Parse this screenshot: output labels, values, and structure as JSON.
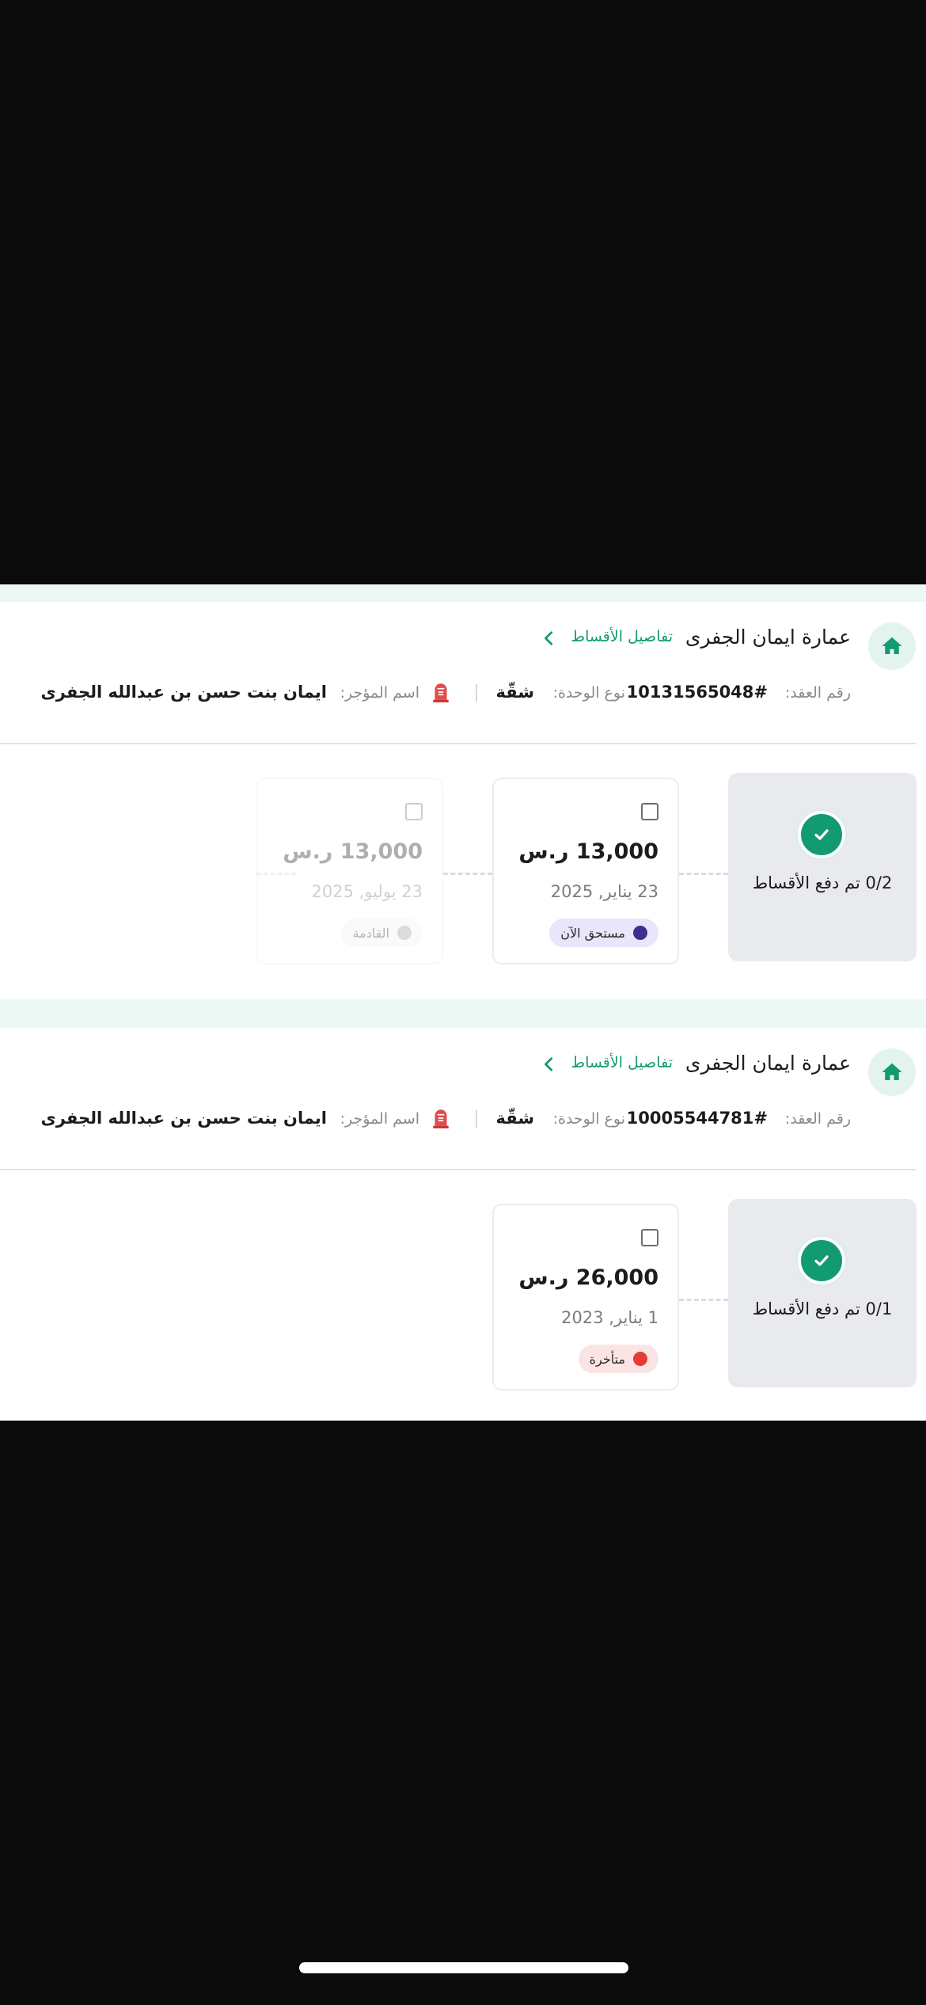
{
  "colors": {
    "accent": "#129a73",
    "due_now_dot": "#3b2f8f",
    "due_now_bg": "#e9e5fb",
    "late_dot": "#e63b3b",
    "late_bg": "#fde4e4",
    "upcoming_dot": "#9a9a9a",
    "upcoming_bg": "#f2f2f2"
  },
  "cards": [
    {
      "icon": "home-icon",
      "title": "عمارة ايمان الجفرى",
      "details_link": "تفاصيل الأقساط",
      "contract_label": "رقم العقد:",
      "contract_value": "10131565048#",
      "unit_label": "نوع الوحدة:",
      "unit_value": "شقّة",
      "lessor_icon": "lessor-icon",
      "lessor_label": "اسم المؤجر:",
      "lessor_value": "ايمان بنت حسن بن عبدالله الجفرى",
      "summary_text": "0/2 تم دفع الأقساط",
      "installments": [
        {
          "amount": "13,000 ر.س",
          "date": "23 يناير, 2025",
          "status": "مستحق الآن",
          "status_type": "due_now",
          "faded": false
        },
        {
          "amount": "13,000 ر.س",
          "date": "23 يوليو, 2025",
          "status": "القادمة",
          "status_type": "upcoming",
          "faded": true
        }
      ]
    },
    {
      "icon": "home-icon",
      "title": "عمارة ايمان الجفرى",
      "details_link": "تفاصيل الأقساط",
      "contract_label": "رقم العقد:",
      "contract_value": "10005544781#",
      "unit_label": "نوع الوحدة:",
      "unit_value": "شقّة",
      "lessor_icon": "lessor-icon",
      "lessor_label": "اسم المؤجر:",
      "lessor_value": "ايمان بنت حسن بن عبدالله الجفرى",
      "summary_text": "0/1 تم دفع الأقساط",
      "installments": [
        {
          "amount": "26,000 ر.س",
          "date": "1 يناير, 2023",
          "status": "متأخرة",
          "status_type": "late",
          "faded": false
        }
      ]
    }
  ]
}
